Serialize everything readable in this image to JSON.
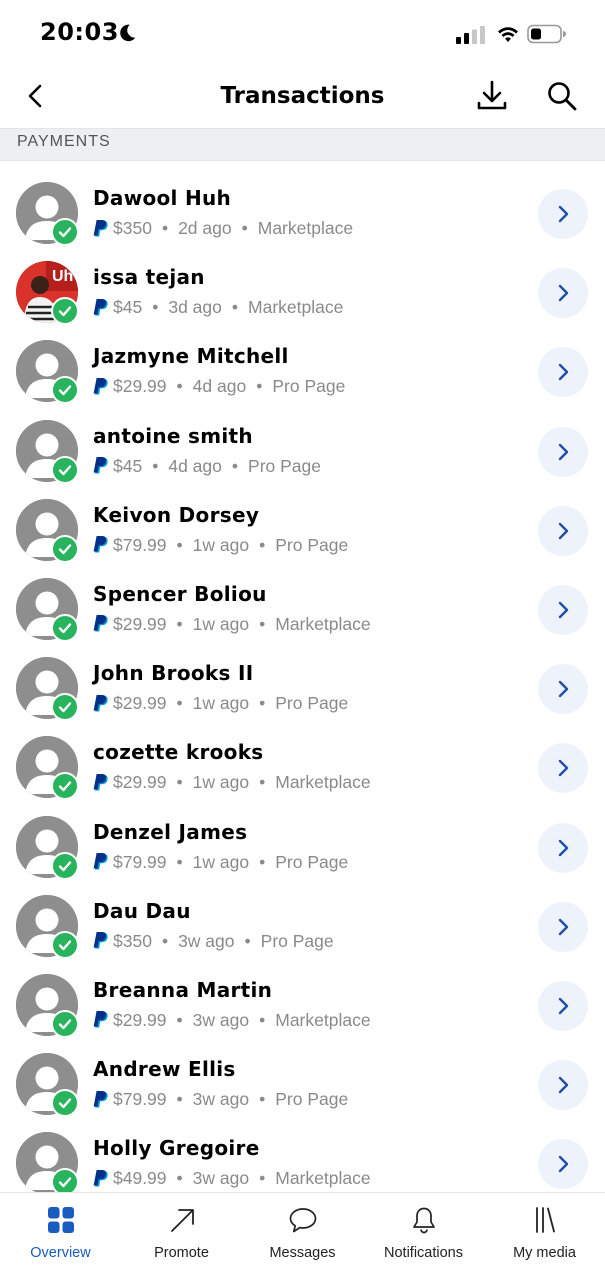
{
  "status_bar": {
    "time": "20:03"
  },
  "header": {
    "title": "Transactions"
  },
  "section": {
    "label": "PAYMENTS"
  },
  "transactions": [
    {
      "name": "Dawool Huh",
      "amount": "$350",
      "when": "2d ago",
      "source": "Marketplace",
      "avatar": "default"
    },
    {
      "name": "issa tejan",
      "amount": "$45",
      "when": "3d ago",
      "source": "Marketplace",
      "avatar": "photo",
      "avatar_text": "Uh"
    },
    {
      "name": "Jazmyne Mitchell",
      "amount": "$29.99",
      "when": "4d ago",
      "source": "Pro Page",
      "avatar": "default"
    },
    {
      "name": "antoine smith",
      "amount": "$45",
      "when": "4d ago",
      "source": "Pro Page",
      "avatar": "default"
    },
    {
      "name": "Keivon Dorsey",
      "amount": "$79.99",
      "when": "1w ago",
      "source": "Pro Page",
      "avatar": "default"
    },
    {
      "name": "Spencer Boliou",
      "amount": "$29.99",
      "when": "1w ago",
      "source": "Marketplace",
      "avatar": "default"
    },
    {
      "name": "John Brooks II",
      "amount": "$29.99",
      "when": "1w ago",
      "source": "Pro Page",
      "avatar": "default"
    },
    {
      "name": "cozette krooks",
      "amount": "$29.99",
      "when": "1w ago",
      "source": "Marketplace",
      "avatar": "default"
    },
    {
      "name": "Denzel James",
      "amount": "$79.99",
      "when": "1w ago",
      "source": "Pro Page",
      "avatar": "default"
    },
    {
      "name": "Dau Dau",
      "amount": "$350",
      "when": "3w ago",
      "source": "Pro Page",
      "avatar": "default"
    },
    {
      "name": "Breanna Martin",
      "amount": "$29.99",
      "when": "3w ago",
      "source": "Marketplace",
      "avatar": "default"
    },
    {
      "name": "Andrew Ellis",
      "amount": "$79.99",
      "when": "3w ago",
      "source": "Pro Page",
      "avatar": "default"
    },
    {
      "name": "Holly Gregoire",
      "amount": "$49.99",
      "when": "3w ago",
      "source": "Marketplace",
      "avatar": "default"
    }
  ],
  "separator": "•",
  "tabs": [
    {
      "label": "Overview",
      "icon": "grid-icon",
      "active": true
    },
    {
      "label": "Promote",
      "icon": "arrow-up-right-icon",
      "active": false
    },
    {
      "label": "Messages",
      "icon": "chat-bubble-icon",
      "active": false
    },
    {
      "label": "Notifications",
      "icon": "bell-icon",
      "active": false
    },
    {
      "label": "My media",
      "icon": "library-icon",
      "active": false
    }
  ],
  "colors": {
    "accent": "#1a5cc0",
    "verified": "#27b45d",
    "chevron_bg": "#edf2fb",
    "paypal_dark": "#003087",
    "paypal_light": "#009cde",
    "muted_text": "#8a8a8a",
    "section_bg": "#eeeff1"
  }
}
